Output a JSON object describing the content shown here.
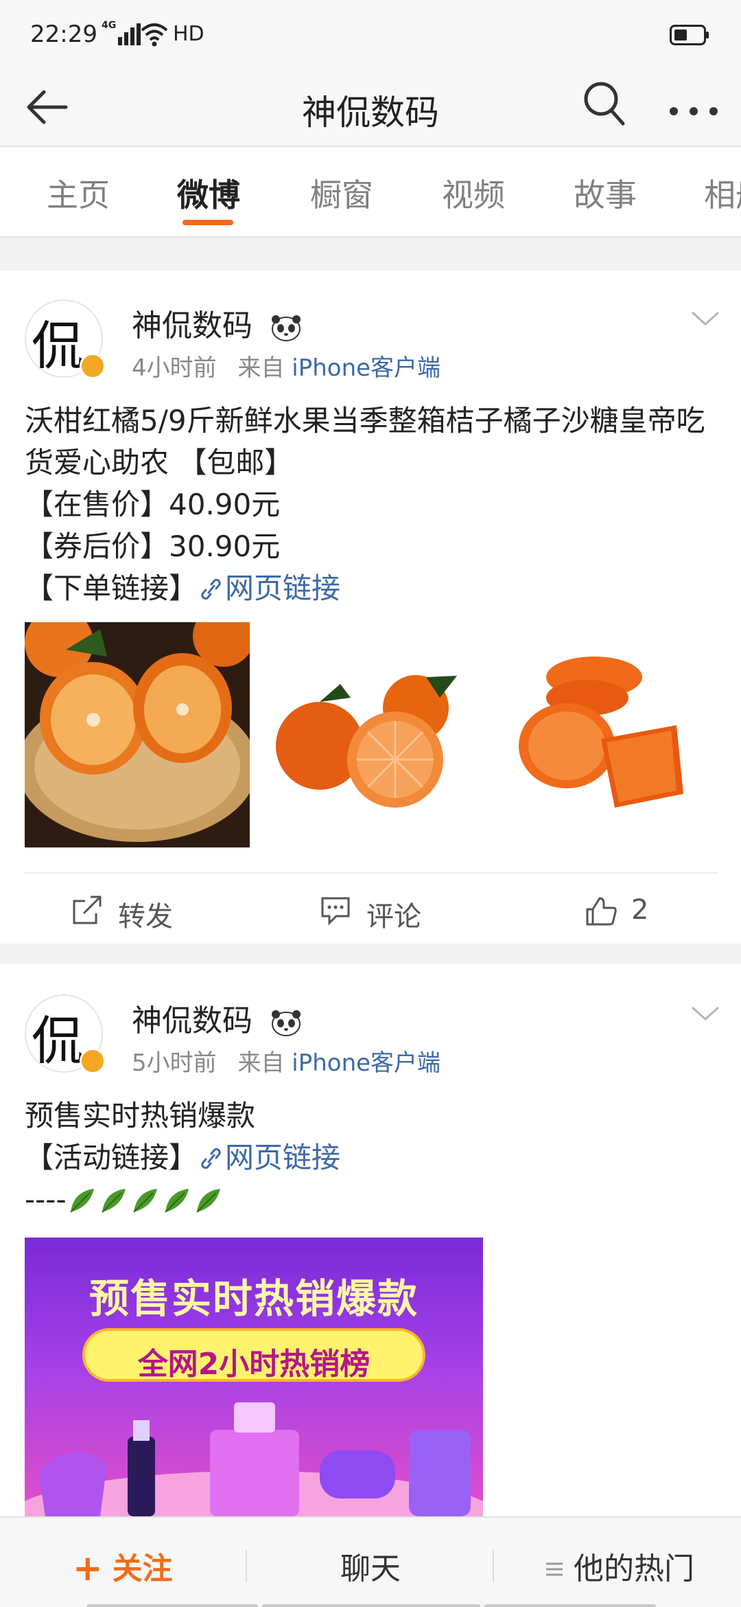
{
  "status_bar": {
    "time": "22:29",
    "network": "4G",
    "hd": "HD"
  },
  "header": {
    "title": "神侃数码"
  },
  "tabs": [
    {
      "label": "主页",
      "active": false
    },
    {
      "label": "微博",
      "active": true
    },
    {
      "label": "橱窗",
      "active": false
    },
    {
      "label": "视频",
      "active": false
    },
    {
      "label": "故事",
      "active": false
    },
    {
      "label": "相册",
      "active": false
    }
  ],
  "colors": {
    "accent": "#f46a1f",
    "link": "#3c69a8",
    "verified": "#f5a623"
  },
  "posts": [
    {
      "author": "神侃数码",
      "avatar_glyph": "侃",
      "time": "4小时前",
      "from_label": "来自",
      "source": "iPhone客户端",
      "lines": [
        "沃柑红橘5/9斤新鲜水果当季整箱桔子橘子沙糖皇帝吃货爱心助农 【包邮】",
        "【在售价】40.90元",
        "【券后价】30.90元"
      ],
      "link_prefix": "【下单链接】",
      "link_text": "网页链接",
      "actions": {
        "repost": "转发",
        "comment": "评论",
        "like_count": "2"
      }
    },
    {
      "author": "神侃数码",
      "avatar_glyph": "侃",
      "time": "5小时前",
      "from_label": "来自",
      "source": "iPhone客户端",
      "lines": [
        "预售实时热销爆款"
      ],
      "link_prefix": "【活动链接】",
      "link_text": "网页链接",
      "dash_line": "----",
      "banner": {
        "title": "预售实时热销爆款",
        "subtitle": "全网2小时热销榜"
      }
    }
  ],
  "bottom_bar": {
    "follow_label": "关注",
    "chat_label": "聊天",
    "hot_label": "他的热门"
  }
}
